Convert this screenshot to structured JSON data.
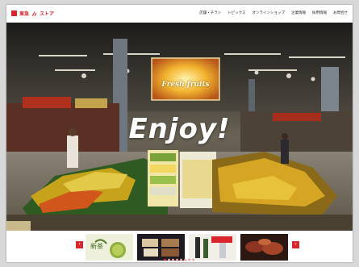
{
  "header": {
    "logo_text": "東急",
    "logo_sub": "ストア",
    "nav": [
      "店舗・チラシ",
      "トピックス",
      "オンラインショップ",
      "企業情報",
      "採用情報",
      "お問合せ"
    ]
  },
  "hero": {
    "title": "Enjoy!",
    "sign_text": "Fresh fruits"
  },
  "carousel": {
    "prev_label": "‹",
    "next_label": "›",
    "thumbnails": [
      {
        "label": "新茶",
        "icon": "tea-icon"
      },
      {
        "label": "",
        "icon": "sweets-icon"
      },
      {
        "label": "",
        "icon": "wine-icon"
      },
      {
        "label": "",
        "icon": "meat-icon"
      }
    ],
    "dot_count": 8,
    "active_dot": 0
  },
  "colors": {
    "brand": "#d9262c",
    "frame_bg": "#d8d8d8"
  }
}
